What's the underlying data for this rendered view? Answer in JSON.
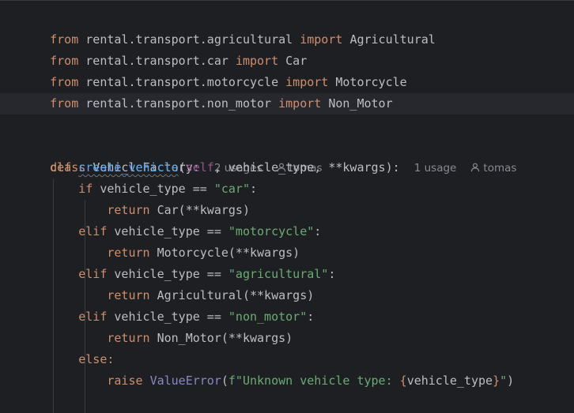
{
  "imports": [
    {
      "from": "from",
      "module": "rental.transport.agricultural",
      "import": "import",
      "name": "Agricultural"
    },
    {
      "from": "from",
      "module": "rental.transport.car",
      "import": "import",
      "name": "Car"
    },
    {
      "from": "from",
      "module": "rental.transport.motorcycle",
      "import": "import",
      "name": "Motorcycle"
    },
    {
      "from": "from",
      "module": "rental.transport.non_motor",
      "import": "import",
      "name": "Non_Motor"
    }
  ],
  "class_def": {
    "kw": "class",
    "name": "VehicleFactory:",
    "usages": "2 usages",
    "author": "tomas"
  },
  "method_def": {
    "kw": "def",
    "name": "create_vehicle",
    "open": "(",
    "self": "self",
    "rest": ", vehicle_type, **kwargs):",
    "usages": "1 usage",
    "author": "tomas"
  },
  "branches": [
    {
      "kw": "if",
      "cond": " vehicle_type == ",
      "str": "\"car\"",
      "colon": ":",
      "ret": "return",
      "call": "Car(**kwargs)"
    },
    {
      "kw": "elif",
      "cond": " vehicle_type == ",
      "str": "\"motorcycle\"",
      "colon": ":",
      "ret": "return",
      "call": "Motorcycle(**kwargs)"
    },
    {
      "kw": "elif",
      "cond": " vehicle_type == ",
      "str": "\"agricultural\"",
      "colon": ":",
      "ret": "return",
      "call": "Agricultural(**kwargs)"
    },
    {
      "kw": "elif",
      "cond": " vehicle_type == ",
      "str": "\"non_motor\"",
      "colon": ":",
      "ret": "return",
      "call": "Non_Motor(**kwargs)"
    }
  ],
  "else_line": {
    "kw": "else:"
  },
  "raise_line": {
    "kw": "raise",
    "exc": "ValueError",
    "open": "(",
    "fstr1": "f\"Unknown vehicle type: ",
    "brace_open": "{",
    "var": "vehicle_type",
    "brace_close": "}",
    "fstr2": "\"",
    "close": ")"
  },
  "colors": {
    "background": "#1e1f22",
    "keyword": "#cf8e6d",
    "function": "#56a8f5",
    "string": "#6aab73",
    "self": "#94558d",
    "builtin": "#8888c6",
    "hint": "#868a91",
    "text": "#bcbec4"
  }
}
